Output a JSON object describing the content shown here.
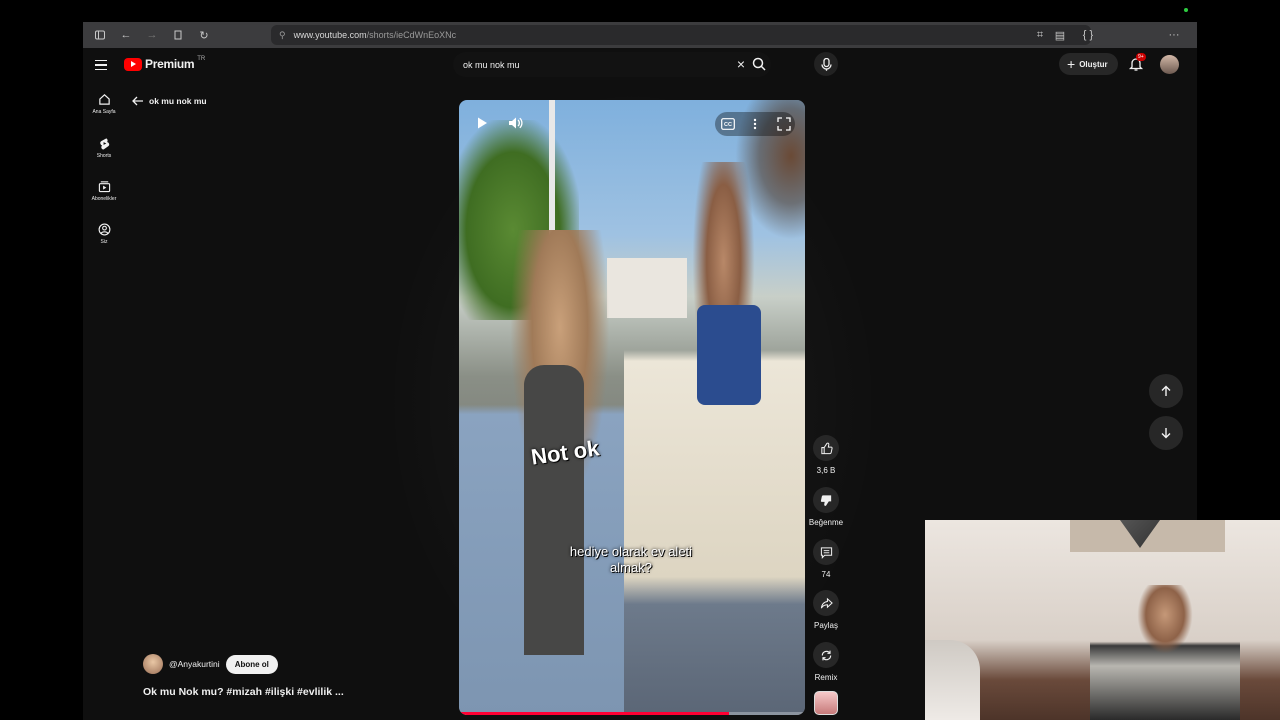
{
  "browser": {
    "url_host": "www.youtube.com",
    "url_path": "/shorts/ieCdWnEoXNc"
  },
  "header": {
    "logo_text": "Premium",
    "logo_region": "TR",
    "search_query": "ok mu nok mu",
    "create_label": "Oluştur",
    "notification_badge": "9+"
  },
  "sidebar": {
    "items": [
      {
        "label": "Ana Sayfa",
        "icon": "home-icon"
      },
      {
        "label": "Shorts",
        "icon": "shorts-icon"
      },
      {
        "label": "Abonelikler",
        "icon": "subscriptions-icon"
      },
      {
        "label": "Siz",
        "icon": "you-icon"
      }
    ]
  },
  "back": {
    "label": "ok mu nok mu"
  },
  "video": {
    "caption_big": "Not ok",
    "caption_small": "hediye olarak ev aleti almak?",
    "progress": 0.78,
    "progress_color": "#ff0033"
  },
  "actions": {
    "like_count": "3,6 B",
    "dislike_label": "Beğenme",
    "comment_count": "74",
    "share_label": "Paylaş",
    "remix_label": "Remix"
  },
  "channel": {
    "handle": "@Anyakurtini",
    "subscribe_label": "Abone ol"
  },
  "title": "Ok mu Nok mu? #mizah #ilişki #evlilik ..."
}
